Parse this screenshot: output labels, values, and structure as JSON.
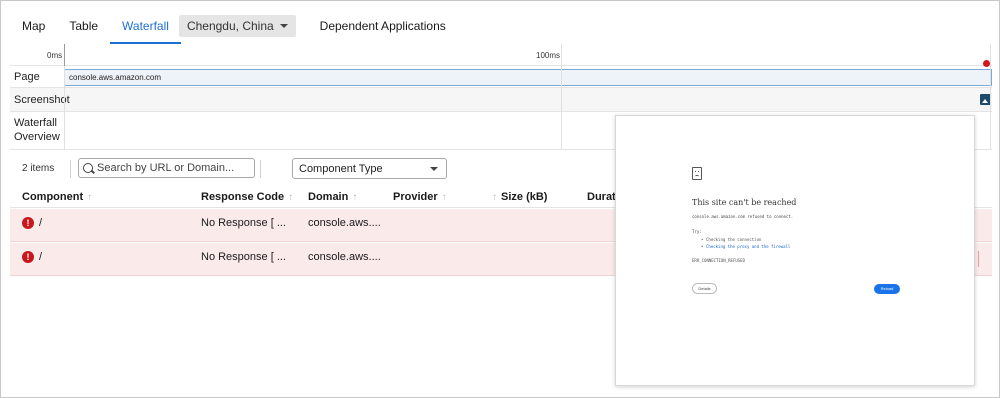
{
  "tabs": [
    {
      "label": "Map"
    },
    {
      "label": "Table"
    },
    {
      "label": "Waterfall"
    }
  ],
  "location": {
    "label": "Chengdu, China"
  },
  "dependent_tab": {
    "label": "Dependent Applications"
  },
  "waterfall": {
    "time_start": "0ms",
    "time_mid": "100ms",
    "rows": {
      "page_label": "Page",
      "page_url": "console.aws.amazon.com",
      "screenshot_label": "Screenshot",
      "overview_label": "Waterfall\nOverview"
    }
  },
  "filters": {
    "item_count": "2 items",
    "search_placeholder": "Search by URL or Domain...",
    "component_type": "Component Type"
  },
  "table": {
    "columns": [
      "Component",
      "Response Code",
      "Domain",
      "Provider",
      "Size (kB)",
      "Duratio"
    ],
    "rows": [
      {
        "component": "/",
        "response": "No Response [ ...",
        "domain": "console.aws...."
      },
      {
        "component": "/",
        "response": "No Response [ ...",
        "domain": "console.aws...."
      }
    ]
  },
  "preview": {
    "title": "This site can't be reached",
    "subtitle": "console.aws.amazon.com refused to connect.",
    "try_label": "Try:",
    "suggestions": [
      "Checking the connection",
      "Checking the proxy and the firewall"
    ],
    "error_code": "ERR_CONNECTION_REFUSED",
    "details_button": "Details",
    "reload_button": "Reload"
  },
  "colors": {
    "accent": "#1f6fd1",
    "error": "#c8161d",
    "row_error_bg": "#fbeaea"
  }
}
